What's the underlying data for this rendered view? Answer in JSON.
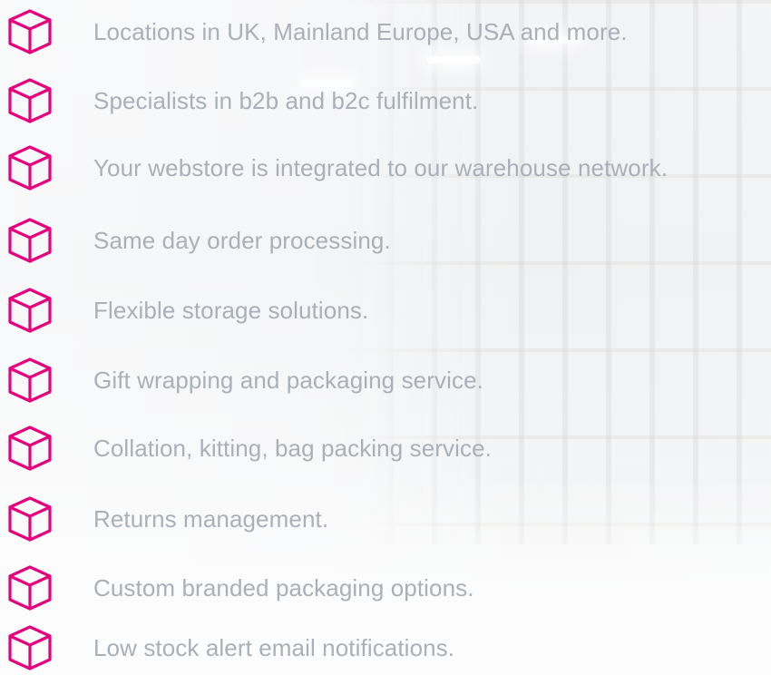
{
  "accent_color": "#e5007d",
  "text_color": "#a9b0b8",
  "icon_name": "box-icon",
  "features": [
    {
      "label": "Locations in UK, Mainland Europe, USA and more."
    },
    {
      "label": "Specialists in b2b and b2c fulfilment."
    },
    {
      "label": "Your webstore is integrated to our warehouse network."
    },
    {
      "label": "Same day order processing."
    },
    {
      "label": "Flexible storage solutions."
    },
    {
      "label": "Gift wrapping and packaging service."
    },
    {
      "label": "Collation, kitting, bag packing service."
    },
    {
      "label": "Returns management."
    },
    {
      "label": "Custom branded packaging options."
    },
    {
      "label": "Low stock alert email notifications."
    }
  ]
}
